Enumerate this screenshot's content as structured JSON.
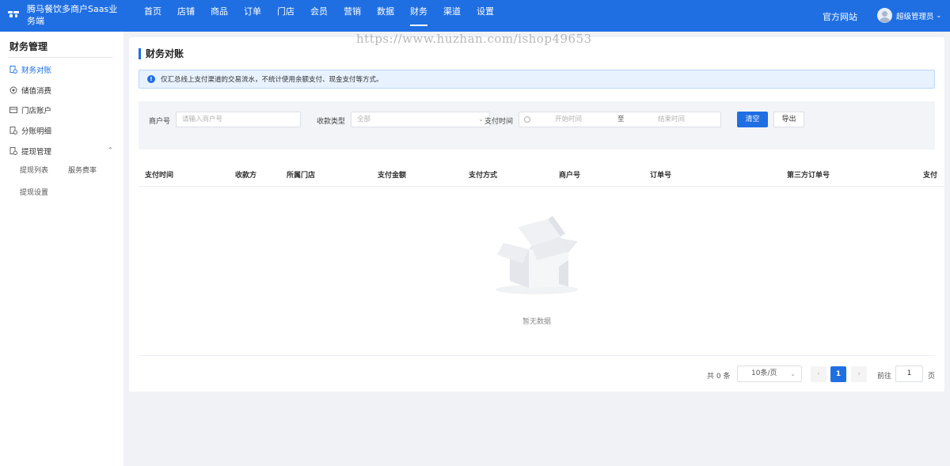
{
  "header": {
    "brand": "腾马餐饮多商户Saas业务端",
    "nav": [
      "首页",
      "店铺",
      "商品",
      "订单",
      "门店",
      "会员",
      "营销",
      "数据",
      "财务",
      "渠道",
      "设置"
    ],
    "active_nav": "财务",
    "official_site": "官方网站",
    "user_name": "超级管理员",
    "user_caret": "⌄",
    "accent_color": "#1f6fe3"
  },
  "sidebar": {
    "title": "财务管理",
    "items": [
      {
        "label": "财务对账",
        "icon": "ledger-icon",
        "active": true
      },
      {
        "label": "储值消费",
        "icon": "coin-icon"
      },
      {
        "label": "门店账户",
        "icon": "card-icon"
      },
      {
        "label": "分账明细",
        "icon": "ledger-icon"
      },
      {
        "label": "提现管理",
        "icon": "ledger-icon",
        "expanded": true
      }
    ],
    "caret": "⌃",
    "sub_items": [
      "提现列表",
      "服务费率",
      "提现设置"
    ]
  },
  "main": {
    "title": "财务对账",
    "notice": "仅汇总线上支付渠道的交易流水，不统计使用余额支付、现金支付等方式。",
    "filters": {
      "merchant_label": "商户号",
      "merchant_placeholder": "请输入商户号",
      "type_label": "收款类型",
      "type_value": "全部",
      "time_label": "支付时间",
      "start_placeholder": "开始时间",
      "range_sep": "至",
      "end_placeholder": "结束时间",
      "clear_button": "清空",
      "export_button": "导出"
    },
    "columns": [
      "支付时间",
      "收款方",
      "所属门店",
      "支付金额",
      "支付方式",
      "商户号",
      "订单号",
      "第三方订单号",
      "支付"
    ],
    "empty_text": "暂无数据",
    "pagination": {
      "total_text": "共 0 条",
      "page_size": "10条/页",
      "prev": "‹",
      "current_page": "1",
      "next": "›",
      "goto_label": "前往",
      "goto_value": "1",
      "page_suffix": "页"
    }
  },
  "watermark": "https://www.huzhan.com/ishop49653"
}
